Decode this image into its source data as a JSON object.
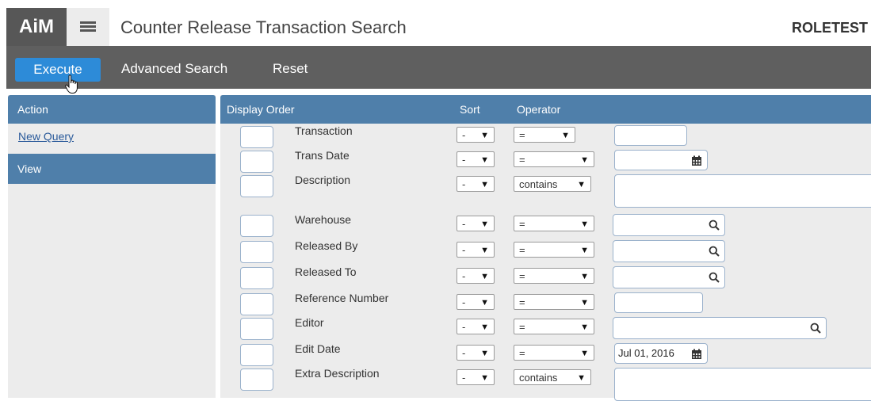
{
  "header": {
    "logo": "AiM",
    "title": "Counter Release Transaction Search",
    "user": "ROLETEST"
  },
  "toolbar": {
    "execute": "Execute",
    "advanced_search": "Advanced Search",
    "reset": "Reset"
  },
  "left_panel": {
    "action_header": "Action",
    "new_query": "New Query",
    "view_header": "View"
  },
  "grid": {
    "col_display_order": "Display Order",
    "col_sort": "Sort",
    "col_operator": "Operator"
  },
  "rows": [
    {
      "label": "Transaction",
      "sort": "-",
      "operator": "=",
      "value": "",
      "icon": "none"
    },
    {
      "label": "Trans Date",
      "sort": "-",
      "operator": "=",
      "value": "",
      "icon": "calendar-icon"
    },
    {
      "label": "Description",
      "sort": "-",
      "operator": "contains",
      "value": "",
      "icon": "none"
    },
    {
      "label": "Warehouse",
      "sort": "-",
      "operator": "=",
      "value": "",
      "icon": "search-icon"
    },
    {
      "label": "Released By",
      "sort": "-",
      "operator": "=",
      "value": "",
      "icon": "search-icon"
    },
    {
      "label": "Released To",
      "sort": "-",
      "operator": "=",
      "value": "",
      "icon": "search-icon"
    },
    {
      "label": "Reference Number",
      "sort": "-",
      "operator": "=",
      "value": "",
      "icon": "none"
    },
    {
      "label": "Editor",
      "sort": "-",
      "operator": "=",
      "value": "",
      "icon": "search-icon"
    },
    {
      "label": "Edit Date",
      "sort": "-",
      "operator": "=",
      "value": "Jul 01, 2016",
      "icon": "calendar-icon"
    },
    {
      "label": "Extra Description",
      "sort": "-",
      "operator": "contains",
      "value": "",
      "icon": "none"
    }
  ],
  "colors": {
    "panel_header": "#4f7faa",
    "toolbar": "#5f5f5f",
    "execute_button": "#2d8bd8",
    "logo_bg": "#575757"
  }
}
